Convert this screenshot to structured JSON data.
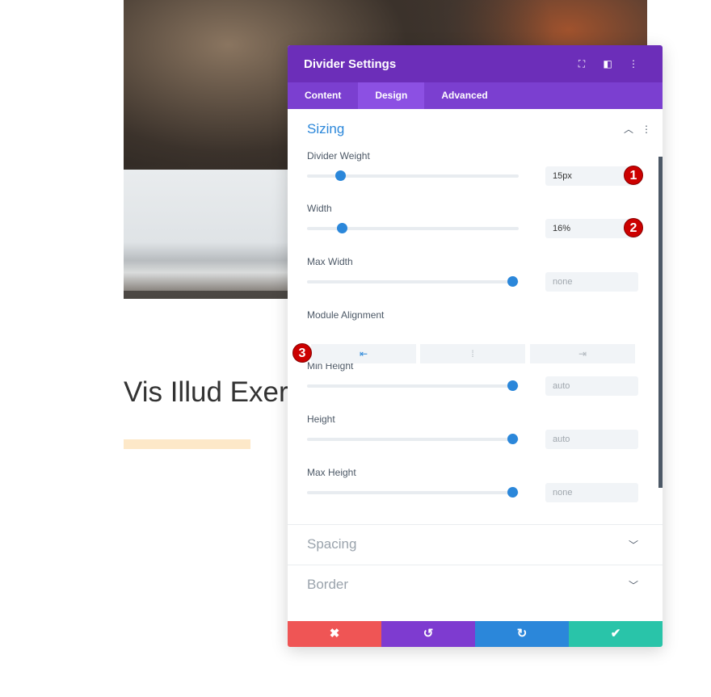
{
  "page": {
    "heading": "Vis Illud Exer"
  },
  "panel": {
    "title": "Divider Settings",
    "header_icons": [
      "fullscreen-icon",
      "split-view-icon",
      "more-icon"
    ],
    "tabs": [
      {
        "label": "Content"
      },
      {
        "label": "Design",
        "active": true
      },
      {
        "label": "Advanced"
      }
    ],
    "section": {
      "title": "Sizing",
      "expanded": true
    },
    "fields": [
      {
        "label": "Divider Weight",
        "value": "15px",
        "slider": 0.16,
        "badge": "1"
      },
      {
        "label": "Width",
        "value": "16%",
        "slider": 0.17,
        "badge": "2"
      },
      {
        "label": "Max Width",
        "placeholder": "none",
        "slider": 1.0
      },
      {
        "label": "Min Height",
        "placeholder": "auto",
        "slider": 1.0
      },
      {
        "label": "Height",
        "placeholder": "auto",
        "slider": 1.0
      },
      {
        "label": "Max Height",
        "placeholder": "none",
        "slider": 1.0
      }
    ],
    "alignment": {
      "label": "Module Alignment",
      "options": [
        "left",
        "center",
        "right"
      ],
      "selected": "left",
      "badge": "3"
    },
    "collapsed_sections": [
      "Spacing",
      "Border"
    ],
    "footer": {
      "colors": {
        "cancel": "#ef5555",
        "undo": "#7e3bd0",
        "redo": "#2b87da",
        "save": "#29c4a9"
      }
    }
  },
  "colors": {
    "header": "#6c2eb9",
    "tabs": "#7b3fd0",
    "accent": "#2b87da",
    "divider_bar": "#fde8c8"
  }
}
